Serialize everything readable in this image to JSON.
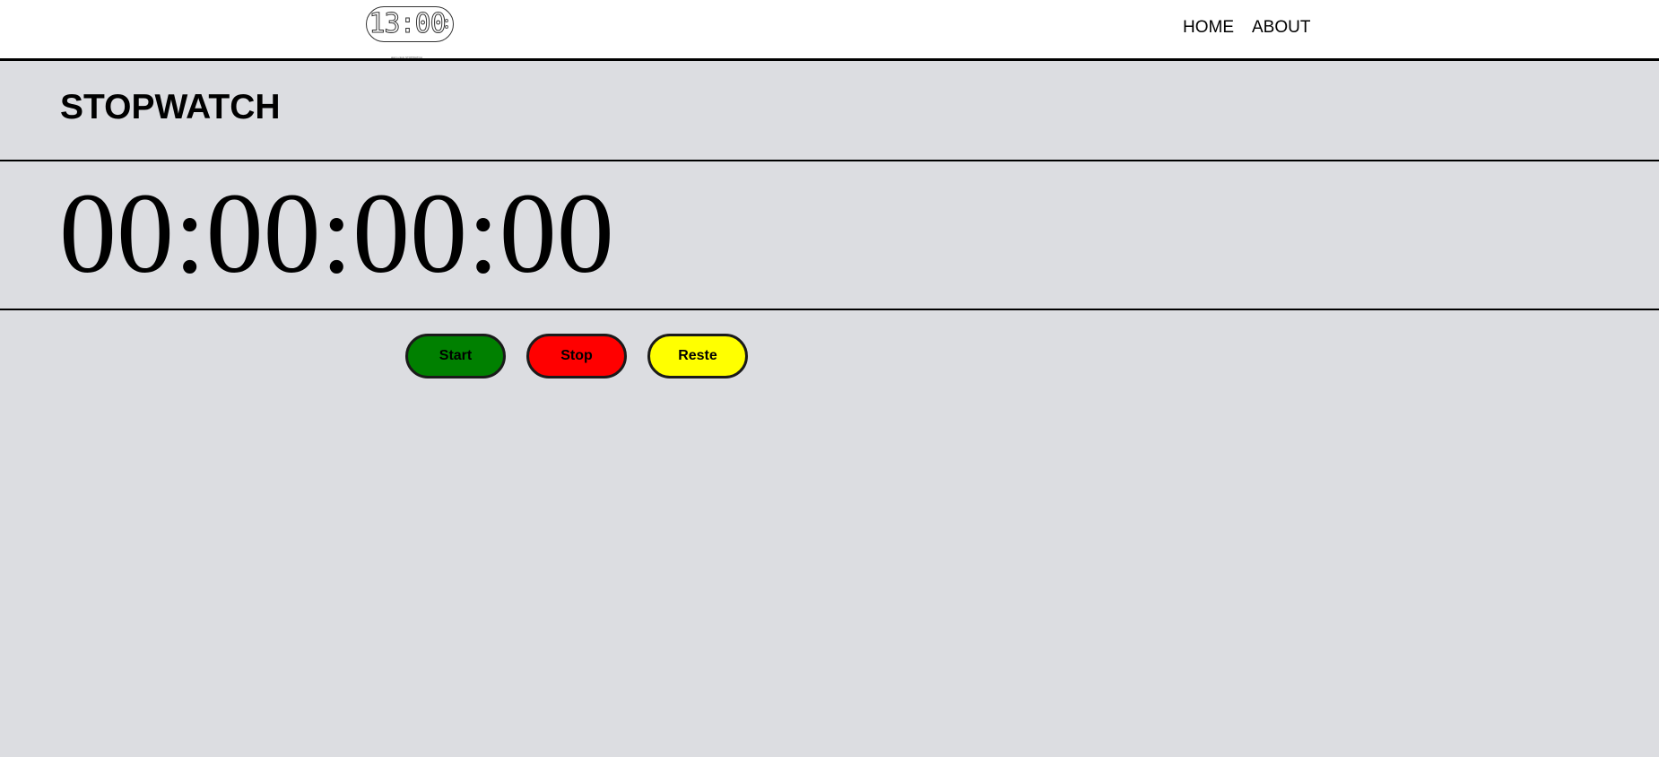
{
  "header": {
    "logo": {
      "digits": "13:00",
      "caption": "alarm clock STOPWATCH"
    },
    "nav": {
      "home_label": "HOME",
      "about_label": "ABOUT"
    }
  },
  "main": {
    "title": "STOPWATCH",
    "timer_value": "00:00:00:00"
  },
  "controls": {
    "start_label": "Start",
    "stop_label": "Stop",
    "reset_label": "Reste"
  },
  "colors": {
    "page_background": "#dcdde1",
    "header_background": "#ffffff",
    "start_button": "#008000",
    "stop_button": "#ff0000",
    "reset_button": "#ffff00"
  }
}
